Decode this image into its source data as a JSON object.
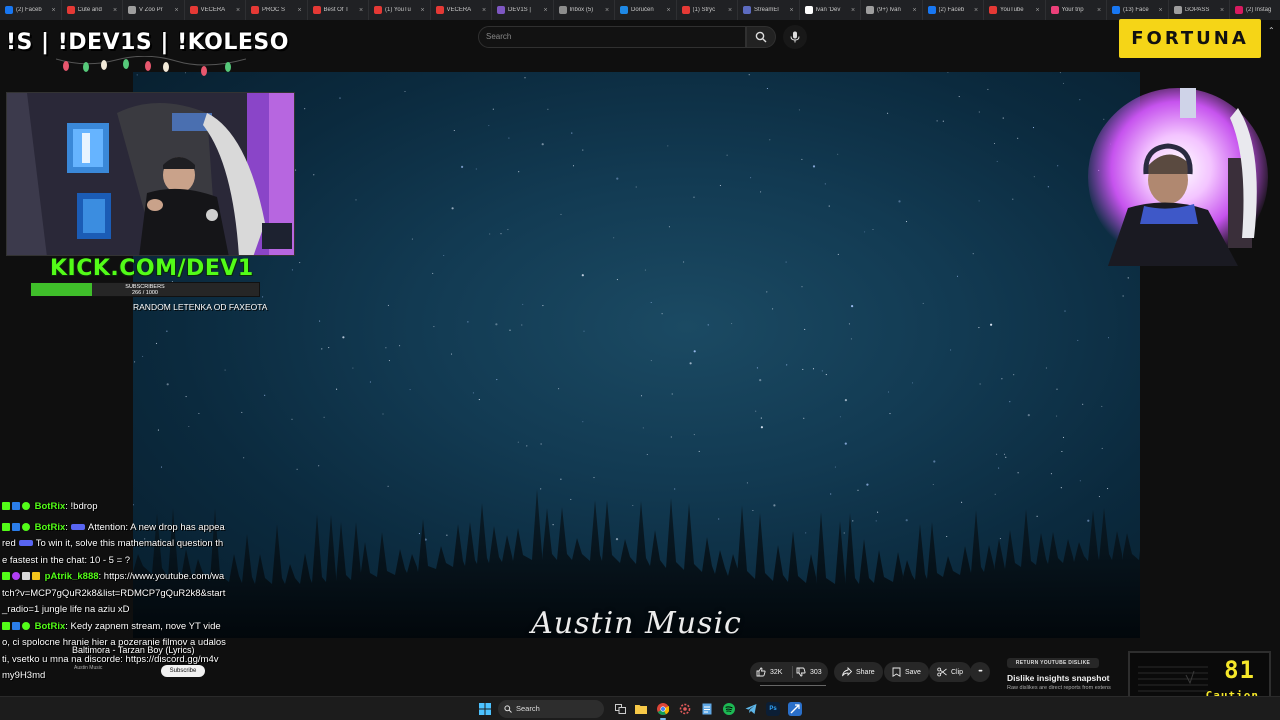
{
  "browser": {
    "tabs": [
      {
        "label": "(2) Faceb",
        "color": "#1877f2"
      },
      {
        "label": "Cute and",
        "color": "#e53935"
      },
      {
        "label": "V Zoo Pr",
        "color": "#9e9e9e"
      },
      {
        "label": "VEČERA",
        "color": "#e53935"
      },
      {
        "label": "PROČ Š",
        "color": "#e53935"
      },
      {
        "label": "Best Of T",
        "color": "#e53935"
      },
      {
        "label": "(1) YouTu",
        "color": "#e53935"
      },
      {
        "label": "VEČERA",
        "color": "#e53935"
      },
      {
        "label": "DEV1S |",
        "color": "#7e57c2"
      },
      {
        "label": "Inbox (5)",
        "color": "#8d8d8d"
      },
      {
        "label": "Doručen",
        "color": "#1e88e5"
      },
      {
        "label": "(1) Strýc",
        "color": "#e53935"
      },
      {
        "label": "StreamEl",
        "color": "#5c6bc0"
      },
      {
        "label": "Ivan 'Dev",
        "color": "#ffffff"
      },
      {
        "label": "(9+) Ivan",
        "color": "#9e9e9e"
      },
      {
        "label": "(2) Faceb",
        "color": "#1877f2"
      },
      {
        "label": "YouTube",
        "color": "#e53935"
      },
      {
        "label": "Your trip",
        "color": "#ec407a"
      },
      {
        "label": "(13) Face",
        "color": "#1877f2"
      },
      {
        "label": "GOPASS",
        "color": "#9e9e9e"
      },
      {
        "label": "(2) Instag",
        "color": "#d81b60"
      }
    ]
  },
  "youtube": {
    "search_placeholder": "Search",
    "video_title_overlay": "Austin Music",
    "now_playing": "Baltimora - Tarzan Boy (Lyrics)",
    "channel_small": "Austin Music",
    "subscribe_label": "Subscribe",
    "actions": {
      "likes": "32K",
      "dislikes": "303",
      "share": "Share",
      "save": "Save",
      "clip": "Clip",
      "more": "•••"
    },
    "dislike_extension": {
      "badge": "RETURN YOUTUBE DISLIKE",
      "title": "Dislike insights snapshot",
      "subtitle": "Raw dislikes are direct reports from extens"
    }
  },
  "stream_overlay": {
    "title": "!S | !DEV1S | !KOLESO",
    "kick_logo": "KICK.COM/DEV1",
    "sub_goal_label": "SUBSCRIBERS",
    "sub_goal_count": "266 / 1000",
    "sub_goal_progress": 0.266,
    "random_text": "RANDOM LETENKA OD FAXEOTA",
    "sponsor": "FORTUNA",
    "meter_value": "81",
    "meter_label": "Caution"
  },
  "chat": [
    {
      "user": "BotRix",
      "color": "#53fc18",
      "text": ": !bdrop"
    },
    {
      "user": "BotRix",
      "color": "#53fc18",
      "text_a": ":",
      "text_b": "Attention: A new drop has appeared",
      "text_c": "To win it, solve this mathematical question the fastest in the chat: 10 - 5 = ?"
    },
    {
      "user": "pAtrik_k888",
      "color": "#53fc18",
      "text": ": https://www.youtube.com/watch?v=MCP7gQuR2k8&list=RDMCP7gQuR2k8&start_radio=1 jungle life na aziu xD"
    },
    {
      "user": "BotRix",
      "color": "#53fc18",
      "text": ": Kedy zapnem stream, nove YT video, ci spolocne hranie hier a pozeranie filmov a udalosti, vsetko u mna na discorde: https://discord.gg/m4vmy9H3md"
    }
  ],
  "taskbar": {
    "search_label": "Search"
  }
}
